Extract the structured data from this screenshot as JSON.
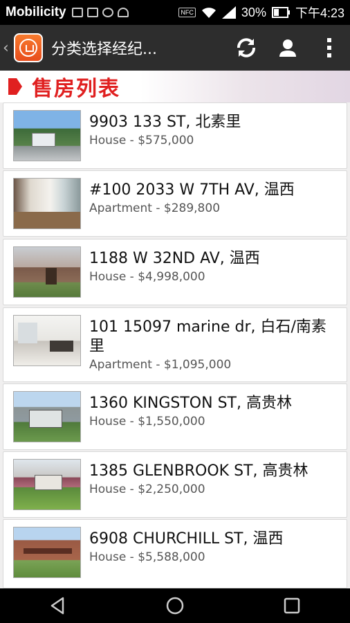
{
  "status_bar": {
    "carrier": "Mobilicity",
    "nfc": "NFC",
    "battery": "30%",
    "time": "下午4:23"
  },
  "app_bar": {
    "title": "分类选择经纪..."
  },
  "section": {
    "title": "售房列表"
  },
  "listings": [
    {
      "address": "9903 133 ST, 北素里",
      "detail": "House - $575,000"
    },
    {
      "address": "#100 2033 W 7TH AV, 温西",
      "detail": "Apartment - $289,800"
    },
    {
      "address": "1188 W 32ND AV, 温西",
      "detail": "House - $4,998,000"
    },
    {
      "address": "101 15097 marine dr, 白石/南素里",
      "detail": "Apartment - $1,095,000"
    },
    {
      "address": "1360 KINGSTON ST, 高贵林",
      "detail": "House - $1,550,000"
    },
    {
      "address": "1385 GLENBROOK ST, 高贵林",
      "detail": "House - $2,250,000"
    },
    {
      "address": "6908 CHURCHILL ST, 温西",
      "detail": "House - $5,588,000"
    }
  ],
  "colors": {
    "accent_red": "#e02020",
    "app_bar": "#2d2d2d"
  }
}
